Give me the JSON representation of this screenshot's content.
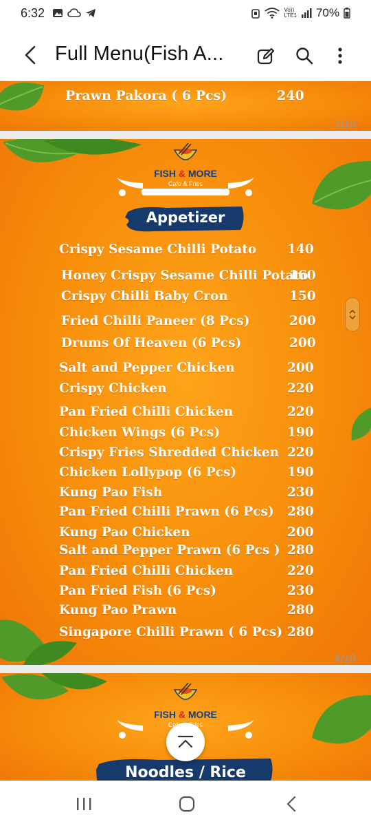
{
  "status_bar": {
    "time": "6:32",
    "battery": "70%",
    "network_label_top": "Vo))",
    "network_label_bottom": "LTE1"
  },
  "app_bar": {
    "title": "Full Menu(Fish A...",
    "icons": [
      "back-arrow-icon",
      "edit-icon",
      "search-icon",
      "more-vert-icon"
    ]
  },
  "pages": [
    {
      "page_label": "3/10",
      "items": [
        {
          "name": "Prawn Pakora ( 6 Pcs)",
          "price": "240"
        }
      ]
    },
    {
      "page_label": "4/10",
      "logo": {
        "brand_left": "FISH",
        "brand_amp": "&",
        "brand_right": "MORE",
        "sub": "Cafe & Fries"
      },
      "section": "Appetizer",
      "items": [
        {
          "name": "Crispy Sesame Chilli Potato",
          "price": "140"
        },
        {
          "name": "Honey Crispy Sesame Chilli Potato",
          "price": "160"
        },
        {
          "name": "Crispy Chilli Baby Cron",
          "price": "150"
        },
        {
          "name": "Fried Chilli Paneer (8 Pcs)",
          "price": "200"
        },
        {
          "name": "Drums Of Heaven (6 Pcs)",
          "price": "200"
        },
        {
          "name": "Salt and Pepper Chicken",
          "price": "200"
        },
        {
          "name": "Crispy Chicken",
          "price": "220"
        },
        {
          "name": "Pan Fried Chilli Chicken",
          "price": "220"
        },
        {
          "name": "Chicken Wings (6 Pcs)",
          "price": "190"
        },
        {
          "name": "Crispy Fries Shredded Chicken",
          "price": "220"
        },
        {
          "name": "Chicken Lollypop (6 Pcs)",
          "price": "190"
        },
        {
          "name": "Kung Pao Fish",
          "price": "230"
        },
        {
          "name": "Pan Fried Chilli Prawn (6 Pcs)",
          "price": "280"
        },
        {
          "name": "Kung Pao Chicken",
          "price": "200"
        },
        {
          "name": "Salt and Pepper Prawn (6 Pcs )",
          "price": "280"
        },
        {
          "name": "Pan Fried Chilli Chicken",
          "price": "220"
        },
        {
          "name": "Pan Fried Fish (6 Pcs)",
          "price": "230"
        },
        {
          "name": "Kung Pao Prawn",
          "price": "280"
        },
        {
          "name": "Singapore Chilli Prawn ( 6 Pcs)",
          "price": "280"
        }
      ]
    },
    {
      "logo": {
        "brand_left": "FISH",
        "brand_amp": "&",
        "brand_right": "MORE",
        "sub": "Cafe & Fries"
      },
      "section": "Noodles / Rice"
    }
  ],
  "colors": {
    "page_orange": "#f78d0a",
    "banner_navy": "#163a6b",
    "brand_blue": "#1a3d7a",
    "brand_red": "#d82020",
    "leaf_green": "#4f9a28"
  },
  "nav_bar": {
    "icons": [
      "recents-icon",
      "home-icon",
      "back-icon"
    ]
  }
}
